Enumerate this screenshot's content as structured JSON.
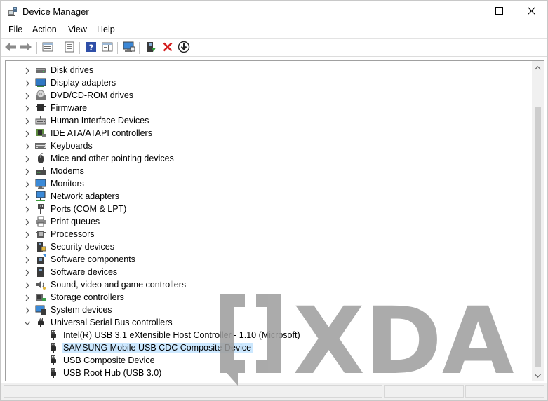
{
  "window": {
    "title": "Device Manager",
    "app_icon": "device-manager-icon"
  },
  "title_buttons": {
    "minimize": "minimize-icon",
    "maximize": "maximize-icon",
    "close": "close-icon"
  },
  "menu": [
    {
      "label": "File"
    },
    {
      "label": "Action"
    },
    {
      "label": "View"
    },
    {
      "label": "Help"
    }
  ],
  "toolbar": [
    {
      "icon": "back-arrow-icon"
    },
    {
      "icon": "forward-arrow-icon"
    },
    {
      "icon": "properties-icon"
    },
    {
      "icon": "show-hidden-icon"
    },
    {
      "icon": "help-icon"
    },
    {
      "icon": "action-pane-icon"
    },
    {
      "icon": "scan-hardware-icon"
    },
    {
      "icon": "update-driver-icon"
    },
    {
      "icon": "uninstall-device-icon"
    },
    {
      "icon": "enable-device-icon"
    }
  ],
  "tree": [
    {
      "label": "Disk drives",
      "icon": "disk-drive-icon",
      "expanded": false
    },
    {
      "label": "Display adapters",
      "icon": "display-adapter-icon",
      "expanded": false
    },
    {
      "label": "DVD/CD-ROM drives",
      "icon": "dvd-drive-icon",
      "expanded": false
    },
    {
      "label": "Firmware",
      "icon": "firmware-icon",
      "expanded": false
    },
    {
      "label": "Human Interface Devices",
      "icon": "hid-icon",
      "expanded": false
    },
    {
      "label": "IDE ATA/ATAPI controllers",
      "icon": "ide-controller-icon",
      "expanded": false
    },
    {
      "label": "Keyboards",
      "icon": "keyboard-icon",
      "expanded": false
    },
    {
      "label": "Mice and other pointing devices",
      "icon": "mouse-icon",
      "expanded": false
    },
    {
      "label": "Modems",
      "icon": "modem-icon",
      "expanded": false
    },
    {
      "label": "Monitors",
      "icon": "monitor-icon",
      "expanded": false
    },
    {
      "label": "Network adapters",
      "icon": "network-adapter-icon",
      "expanded": false
    },
    {
      "label": "Ports (COM & LPT)",
      "icon": "port-icon",
      "expanded": false
    },
    {
      "label": "Print queues",
      "icon": "printer-icon",
      "expanded": false
    },
    {
      "label": "Processors",
      "icon": "processor-icon",
      "expanded": false
    },
    {
      "label": "Security devices",
      "icon": "security-device-icon",
      "expanded": false
    },
    {
      "label": "Software components",
      "icon": "software-component-icon",
      "expanded": false
    },
    {
      "label": "Software devices",
      "icon": "software-device-icon",
      "expanded": false
    },
    {
      "label": "Sound, video and game controllers",
      "icon": "sound-icon",
      "expanded": false
    },
    {
      "label": "Storage controllers",
      "icon": "storage-controller-icon",
      "expanded": false
    },
    {
      "label": "System devices",
      "icon": "system-device-icon",
      "expanded": false
    },
    {
      "label": "Universal Serial Bus controllers",
      "icon": "usb-icon",
      "expanded": true,
      "children": [
        {
          "label": "Intel(R) USB 3.1 eXtensible Host Controller - 1.10 (Microsoft)",
          "icon": "usb-icon",
          "selected": false
        },
        {
          "label": "SAMSUNG Mobile USB CDC Composite Device",
          "icon": "usb-icon",
          "selected": true
        },
        {
          "label": "USB Composite Device",
          "icon": "usb-icon",
          "selected": false
        },
        {
          "label": "USB Root Hub (USB 3.0)",
          "icon": "usb-icon",
          "selected": false
        }
      ]
    }
  ],
  "watermark": {
    "text": "XDA",
    "logo": "xda-logo"
  },
  "colors": {
    "selection": "#cce8ff",
    "watermark": "#9c9c9c"
  }
}
